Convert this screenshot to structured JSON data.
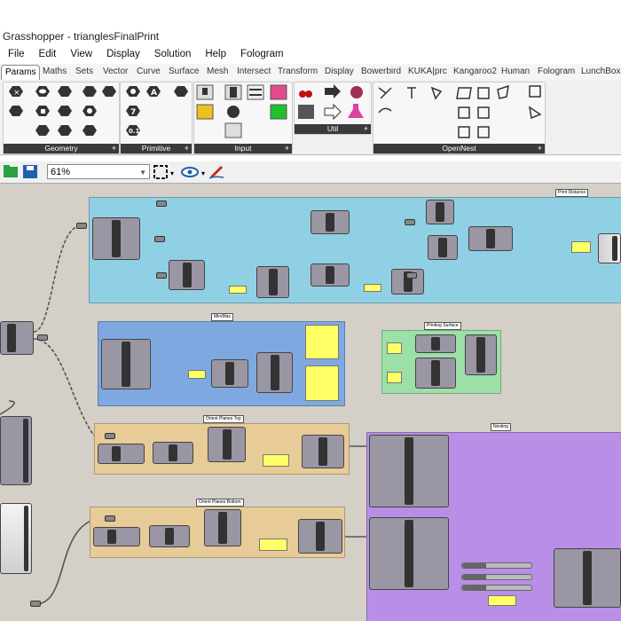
{
  "window": {
    "title": "Grasshopper - trianglesFinalPrint"
  },
  "menu": [
    "File",
    "Edit",
    "View",
    "Display",
    "Solution",
    "Help",
    "Fologram"
  ],
  "tabs": [
    "Params",
    "Maths",
    "Sets",
    "Vector",
    "Curve",
    "Surface",
    "Mesh",
    "Intersect",
    "Transform",
    "Display",
    "Bowerbird",
    "KUKA|prc",
    "Kangaroo2",
    "Human",
    "Fologram",
    "LunchBox"
  ],
  "active_tab": "Params",
  "ribbon_panels": [
    {
      "label": "Geometry"
    },
    {
      "label": "Primitive"
    },
    {
      "label": "Input"
    },
    {
      "label": "Util"
    },
    {
      "label": "OpenNest"
    }
  ],
  "toolbar": {
    "zoom": "61%"
  },
  "groups": {
    "print_distance": "Print Distance",
    "minmax": "Min/Max",
    "printing_surface": "Printing Surface",
    "orient_planes_top": "Orient Planes Top",
    "nesting": "Nesting",
    "orient_planes_bottom": "Orient Planes Bottom"
  },
  "colors": {
    "group_cyan": "#8fd0e4",
    "group_blue": "#7fa8e0",
    "group_green": "#9ce0a8",
    "group_tan": "#e8cc98",
    "group_purple": "#b88ee6",
    "canvas": "#d4d0c8",
    "panel_yellow": "#ffff66"
  }
}
